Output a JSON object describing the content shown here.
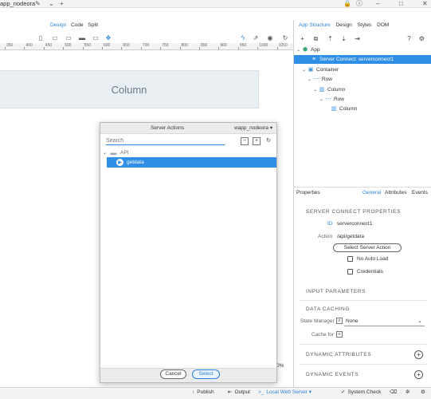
{
  "topbar": {
    "title": "app_nodeora"
  },
  "toolbar": {
    "modes": [
      "Design",
      "Code",
      "Split"
    ],
    "active_mode": "Design"
  },
  "ruler": {
    "ticks": [
      "350",
      "400",
      "450",
      "500",
      "550",
      "600",
      "650",
      "700",
      "750",
      "800",
      "850",
      "900",
      "950",
      "1000",
      "1050"
    ]
  },
  "canvas": {
    "column_label": "Column",
    "zoom": "0%"
  },
  "dialog": {
    "title": "Server Actions",
    "app": "wapp_nodeora",
    "search_placeholder": "Search",
    "tree": {
      "folder": "API",
      "selected_item": "getdata"
    },
    "cancel": "Cancel",
    "select": "Select"
  },
  "right_panel": {
    "tabs": [
      "App Structure",
      "Design",
      "Styles",
      "DOM"
    ],
    "active_tab": "App Structure",
    "tree": [
      {
        "label": "App",
        "icon": "app-cube-icon",
        "indent": 0
      },
      {
        "label": "Server Connect: serverconnect1",
        "icon": "server-connect-icon",
        "indent": 0,
        "selected": true
      },
      {
        "label": "Container",
        "icon": "container-icon",
        "indent": 1
      },
      {
        "label": "Row",
        "icon": "row-icon",
        "indent": 2
      },
      {
        "label": "Column",
        "icon": "column-icon",
        "indent": 3
      },
      {
        "label": "Row",
        "icon": "row-icon",
        "indent": 4
      },
      {
        "label": "Column",
        "icon": "column-icon",
        "indent": 5
      }
    ]
  },
  "properties": {
    "title": "Properties",
    "tabs": [
      "General",
      "Attributes",
      "Events"
    ],
    "active_tab": "General",
    "server_connect_header": "SERVER CONNECT PROPERTIES",
    "id_label": "ID",
    "id_value": "serverconnect1",
    "action_label": "Action",
    "action_value": "/api/getdata",
    "select_server_action": "Select Server Action",
    "no_auto_load": "No Auto Load",
    "credentials": "Credentials",
    "input_parameters": "INPUT PARAMETERS",
    "data_caching": "DATA CACHING",
    "state_manager_label": "State Manager",
    "state_manager_value": "None",
    "cache_for_label": "Cache for",
    "dynamic_attributes": "DYNAMIC ATTRIBUTES",
    "dynamic_events": "DYNAMIC EVENTS"
  },
  "statusbar": {
    "publish": "Publish",
    "output": "Output",
    "server": "Local Web Server",
    "system_check": "System Check"
  },
  "colors": {
    "accent": "#2b84d9",
    "selection": "#2f8ee5"
  }
}
